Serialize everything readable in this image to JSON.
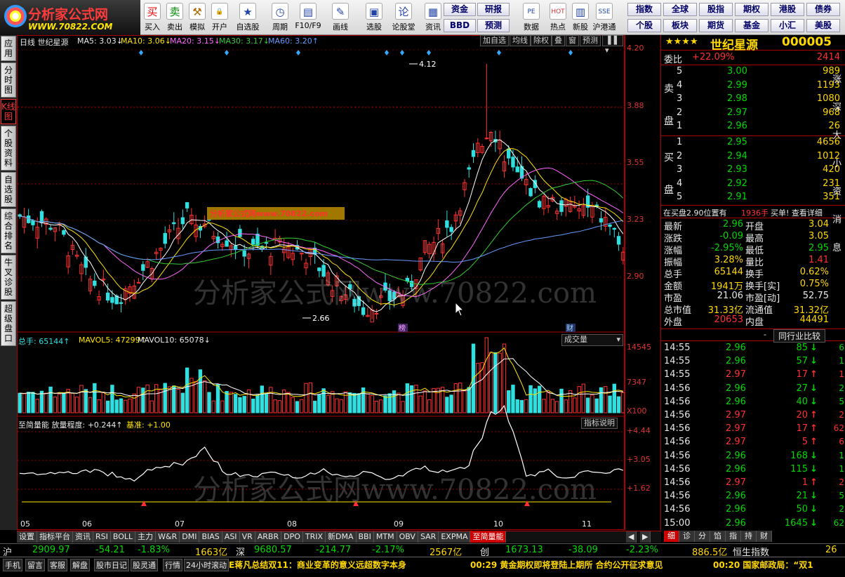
{
  "logo": {
    "name": "分析家公式网",
    "url": "WWW.70822.COM"
  },
  "toolbar": [
    {
      "label": "买入",
      "icon": "买",
      "color": "#e00"
    },
    {
      "label": "卖出",
      "icon": "卖",
      "color": "#080"
    },
    {
      "label": "模拟",
      "icon": "⚒",
      "color": "#a60"
    },
    {
      "label": "开户",
      "icon": "🔒",
      "color": "#666"
    },
    {
      "label": "自选股",
      "icon": "★",
      "color": "#24a"
    },
    {
      "label": "周期",
      "icon": "◷",
      "color": "#24a"
    },
    {
      "label": "F10/F9",
      "icon": "▤",
      "color": "#24a"
    },
    {
      "label": "画线",
      "icon": "✎",
      "color": "#24a"
    },
    {
      "label": "选股",
      "icon": "▣",
      "color": "#24a"
    },
    {
      "label": "论股堂",
      "icon": "论",
      "color": "#24a"
    },
    {
      "label": "资讯",
      "icon": "▦",
      "color": "#24a"
    },
    {
      "label": "数据",
      "icon": "PE",
      "color": "#24a"
    },
    {
      "label": "热点",
      "icon": "HOT",
      "color": "#c33"
    },
    {
      "label": "新股",
      "icon": "▥",
      "color": "#24a"
    },
    {
      "label": "沪港通",
      "icon": "SSE",
      "color": "#24a"
    }
  ],
  "menu_btns_a": [
    "资金",
    "研报",
    "BBD",
    "预测"
  ],
  "menu_btns_b": [
    "指数",
    "全球",
    "股指",
    "期权",
    "港股",
    "债券",
    "个股",
    "板块",
    "期货",
    "基金",
    "小汇",
    "美股"
  ],
  "sidetabs": [
    "应用",
    "分时图",
    "K线图",
    "个股资料",
    "自选股",
    "综合排名",
    "牛叉诊股",
    "超级盘口"
  ],
  "chart": {
    "legend_main": [
      "日线  世纪星源",
      "MA5: 3.03↓",
      "MA10: 3.06↓",
      "MA20: 3.15↓",
      "MA30: 3.17↓",
      "MA60: 3.20↑"
    ],
    "buttons": [
      "加自选",
      "均线",
      "除权",
      "叠",
      "窗",
      "预测"
    ],
    "axis_main": [
      "4.20",
      "3.88",
      "3.55",
      "3.23",
      "2.90"
    ],
    "high_label": "4.12",
    "low_label": "2.66",
    "banner": "分析家公式网www.70822.com",
    "watermark": "分析家公式网www.70822.com",
    "badge_bang": "榜",
    "badge_cai": "财",
    "legend_vol": [
      "总手: 65144↑",
      "MAVOL5: 47299↑",
      "MAVOL10: 65078↓"
    ],
    "vol_select": "成交量",
    "axis_vol": [
      "14545",
      "7347",
      "X100"
    ],
    "legend_ind": [
      "至简量能  放量程度: +0.244↑",
      "基准: +1.00"
    ],
    "ind_btn": "指标说明",
    "axis_ind": [
      "+4.44",
      "+3.05",
      "+1.62"
    ],
    "months": [
      "05",
      "06",
      "07",
      "08",
      "09",
      "10",
      "11"
    ]
  },
  "quote": {
    "stars": "★★★★",
    "name": "世纪星源",
    "code": "000005",
    "wei_label": "委比",
    "wei_val": "+22.09%",
    "wei_num": "2414",
    "sell_label": "卖盘",
    "buy_label": "买盘",
    "sells": [
      {
        "n": "5",
        "p": "3.00",
        "v": "989"
      },
      {
        "n": "4",
        "p": "2.99",
        "v": "1193"
      },
      {
        "n": "3",
        "p": "2.98",
        "v": "1080"
      },
      {
        "n": "2",
        "p": "2.97",
        "v": "968"
      },
      {
        "n": "1",
        "p": "2.96",
        "v": "26"
      }
    ],
    "buys": [
      {
        "n": "1",
        "p": "2.95",
        "v": "4656"
      },
      {
        "n": "2",
        "p": "2.94",
        "v": "1012"
      },
      {
        "n": "3",
        "p": "2.93",
        "v": "420"
      },
      {
        "n": "4",
        "p": "2.92",
        "v": "231"
      },
      {
        "n": "5",
        "p": "2.91",
        "v": "351"
      }
    ],
    "pending": "在买盘2.90位置有",
    "pending_num": "1936手",
    "pending_tail": "买单! 查看详细",
    "stats": [
      [
        "最新",
        "2.96",
        "开盘",
        "3.04"
      ],
      [
        "涨跌",
        "-0.09",
        "最高",
        "3.05"
      ],
      [
        "涨幅",
        "-2.95%",
        "最低",
        "2.95"
      ],
      [
        "振幅",
        "3.28%",
        "量比",
        "1.41"
      ],
      [
        "总手",
        "65144",
        "换手",
        "0.62%"
      ],
      [
        "金额",
        "1941万",
        "换手[实]",
        "0.75%"
      ],
      [
        "市盈",
        "21.06",
        "市盈[动]",
        "52.75"
      ],
      [
        "总市值",
        "31.33亿",
        "流通值",
        "31.32亿"
      ],
      [
        "外盘",
        "20653",
        "内盘",
        "44491"
      ]
    ],
    "compare_btn": "同行业比较",
    "ticks": [
      [
        "14:55",
        "2.96",
        "85",
        "down"
      ],
      [
        "14:55",
        "2.96",
        "57",
        "down"
      ],
      [
        "14:55",
        "2.97",
        "17",
        "up"
      ],
      [
        "14:56",
        "2.96",
        "27",
        "down"
      ],
      [
        "14:56",
        "2.96",
        "40",
        "down"
      ],
      [
        "14:56",
        "2.97",
        "20",
        "up"
      ],
      [
        "14:56",
        "2.97",
        "17",
        "up"
      ],
      [
        "14:56",
        "2.97",
        "5",
        "up"
      ],
      [
        "14:56",
        "2.96",
        "168",
        "down"
      ],
      [
        "14:56",
        "2.96",
        "115",
        "down"
      ],
      [
        "14:56",
        "2.97",
        "1",
        "up"
      ],
      [
        "14:56",
        "2.96",
        "21",
        "down"
      ],
      [
        "14:56",
        "2.96",
        "50",
        "down"
      ],
      [
        "15:00",
        "2.96",
        "1645",
        "down"
      ]
    ],
    "side_letters": [
      "涨",
      "深",
      "大",
      "小",
      "资",
      "消",
      "息"
    ],
    "side_nums": [
      "6",
      "1",
      "1",
      "2",
      "5",
      "2",
      "62"
    ]
  },
  "bottom_tabs": [
    "设置",
    "指标平台",
    "资讯",
    "RSI",
    "BOLL",
    "主力",
    "W&R",
    "DMI",
    "BIAS",
    "ASI",
    "VR",
    "ARBR",
    "DPO",
    "TRIX",
    "新DMA",
    "BBI",
    "MTM",
    "OBV",
    "SAR",
    "EXPMA",
    "至简量能"
  ],
  "right_tabs": [
    "细",
    "诊",
    "分",
    "馅",
    "指",
    "持",
    "财"
  ],
  "index_bar": [
    {
      "t": "沪",
      "c": "white"
    },
    {
      "t": "2909.97",
      "c": "green"
    },
    {
      "t": "-54.21",
      "c": "green"
    },
    {
      "t": "-1.83%",
      "c": "green"
    },
    {
      "t": "1663亿",
      "c": "yel"
    },
    {
      "t": "深",
      "c": "white"
    },
    {
      "t": "9680.57",
      "c": "green"
    },
    {
      "t": "-214.77",
      "c": "green"
    },
    {
      "t": "-2.17%",
      "c": "green"
    },
    {
      "t": "2567亿",
      "c": "yel"
    },
    {
      "t": "创",
      "c": "white"
    },
    {
      "t": "1673.13",
      "c": "green"
    },
    {
      "t": "-38.09",
      "c": "green"
    },
    {
      "t": "-2.23%",
      "c": "green"
    },
    {
      "t": "886.5亿",
      "c": "yel"
    },
    {
      "t": "恒生指数",
      "c": "white"
    },
    {
      "t": "26",
      "c": "yel"
    }
  ],
  "status_items": [
    "手机",
    "留言",
    "客服",
    "解盘",
    "股市日记",
    "股灵通",
    "行情",
    "24小时滚动"
  ],
  "news": [
    {
      "t": "E蒋凡总结双11：商业变革的意义远超数字本身",
      "c": "yel"
    },
    {
      "t": "00:29 黄金期权即将登陆上期所 合约公开征求意见",
      "c": "yel"
    },
    {
      "t": "00:20 国家邮政局：“双1",
      "c": "yel"
    }
  ]
}
